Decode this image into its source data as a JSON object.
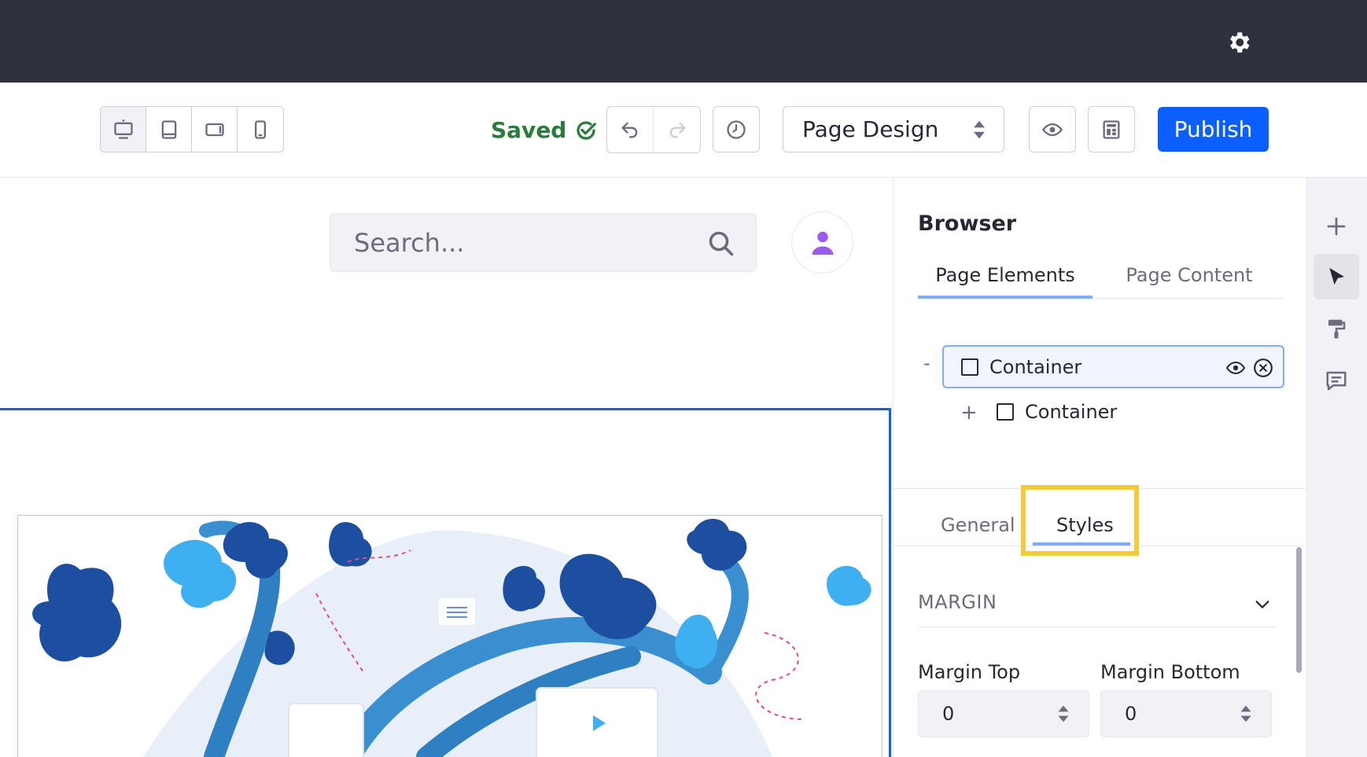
{
  "topbar": {
    "settings_icon": "gear-icon"
  },
  "toolbar": {
    "devices": [
      {
        "name": "desktop-icon",
        "active": true
      },
      {
        "name": "tablet-icon",
        "active": false
      },
      {
        "name": "landscape-phone-icon",
        "active": false
      },
      {
        "name": "portrait-phone-icon",
        "active": false
      }
    ],
    "saved_label": "Saved",
    "experience_select": "Page Design",
    "publish_label": "Publish"
  },
  "canvas": {
    "search_placeholder": "Search..."
  },
  "sidebar": {
    "title": "Browser",
    "tabs": [
      "Page Elements",
      "Page Content"
    ],
    "active_tab": "Page Elements",
    "tree": [
      {
        "label": "Container",
        "toggle": "-",
        "selected": true
      },
      {
        "label": "Container",
        "toggle": "+",
        "selected": false
      }
    ],
    "config_tabs": [
      "General",
      "Styles"
    ],
    "active_config_tab": "Styles",
    "section_title": "MARGIN",
    "fields": [
      {
        "label": "Margin Top",
        "value": "0"
      },
      {
        "label": "Margin Bottom",
        "value": "0"
      }
    ]
  },
  "rail": {
    "items": [
      "plus-icon",
      "cursor-icon",
      "paint-roller-icon",
      "comments-icon"
    ],
    "active": "cursor-icon"
  },
  "colors": {
    "primary": "#0b5fff",
    "success": "#287d3c",
    "highlight": "#f2cb3b",
    "topbar": "#30313f"
  }
}
